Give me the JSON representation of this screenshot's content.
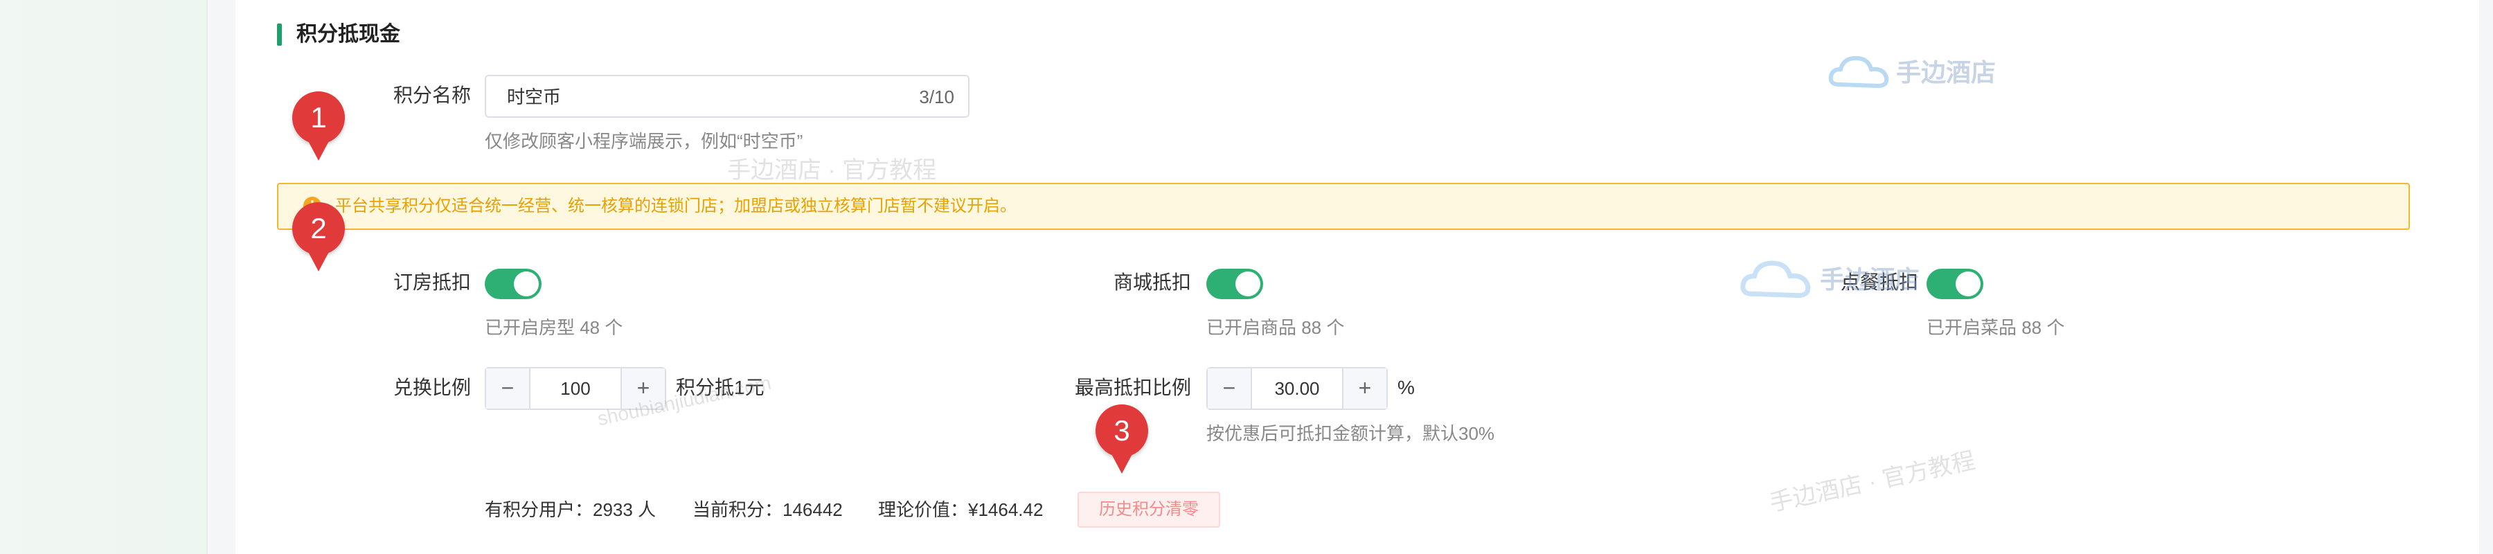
{
  "section": {
    "title": "积分抵现金"
  },
  "points_name": {
    "label": "积分名称",
    "value": "时空币",
    "count": "3/10",
    "hint": "仅修改顾客小程序端展示，例如“时空币”"
  },
  "warning": {
    "icon": "!",
    "text": "平台共享积分仅适合统一经营、统一核算的连锁门店；加盟店或独立核算门店暂不建议开启。"
  },
  "toggles": [
    {
      "label": "订房抵扣",
      "hint": "已开启房型 48 个"
    },
    {
      "label": "商城抵扣",
      "hint": "已开启商品 88 个"
    },
    {
      "label": "点餐抵扣",
      "hint": "已开启菜品 88 个"
    }
  ],
  "exchange": {
    "label": "兑换比例",
    "minus": "−",
    "plus": "+",
    "value": "100",
    "suffix": "积分抵1元"
  },
  "max_deduct": {
    "label": "最高抵扣比例",
    "minus": "−",
    "plus": "+",
    "value": "30.00",
    "suffix": "%",
    "hint": "按优惠后可抵扣金额计算，默认30%"
  },
  "stats": {
    "users": "有积分用户：2933 人",
    "current": "当前积分：146442",
    "value": "理论价值：¥1464.42"
  },
  "clear_button": "历史积分清零",
  "markers": [
    "1",
    "2",
    "3"
  ],
  "watermarks": {
    "brand": "手边酒店",
    "tutorial": "手边酒店 · 官方教程",
    "domain": "shoubianjiudian.com"
  },
  "colors": {
    "accent": "#2eaf74",
    "warning": "#f5b82e",
    "marker": "#e03a3a"
  }
}
